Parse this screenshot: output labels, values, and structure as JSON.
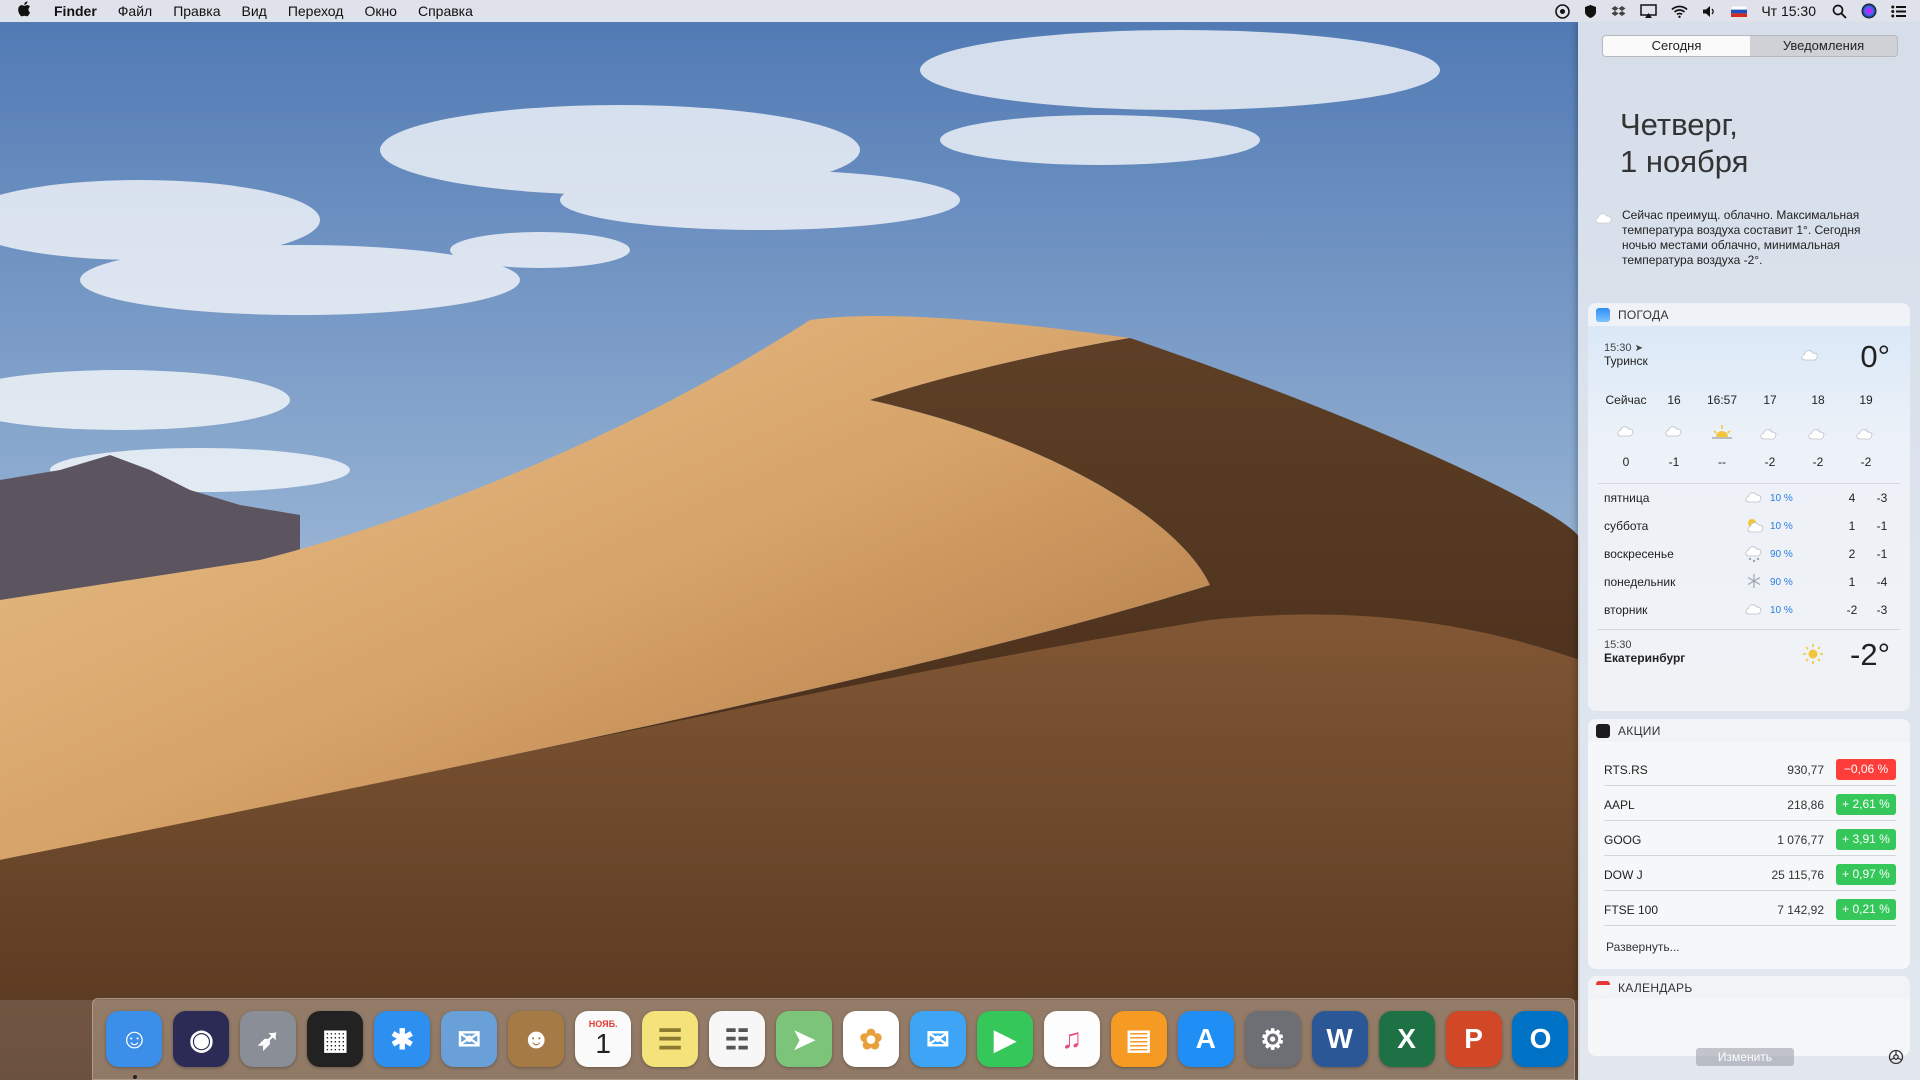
{
  "menubar": {
    "app": "Finder",
    "items": [
      "Файл",
      "Правка",
      "Вид",
      "Переход",
      "Окно",
      "Справка"
    ],
    "clock": "Чт 15:30",
    "status_icons": [
      "info-circle-icon",
      "shield-icon",
      "dropbox-icon",
      "airplay-icon",
      "wifi-icon",
      "volume-icon",
      "russian-flag-icon",
      "search-icon",
      "siri-icon",
      "notification-center-icon"
    ]
  },
  "sidebar": {
    "tabs": [
      "Сегодня",
      "Уведомления"
    ],
    "date_line1": "Четверг,",
    "date_line2": "1 ноября",
    "summary": "Сейчас преимущ. облачно. Максимальная температура воздуха составит 1°. Сегодня ночью местами облачно, минимальная температура воздуха -2°.",
    "weather": {
      "title": "ПОГОДА",
      "location1": {
        "time": "15:30",
        "name": "Туринск",
        "temp": "0°"
      },
      "hours": [
        "Сейчас",
        "16",
        "16:57",
        "17",
        "18",
        "19"
      ],
      "hour_temps": [
        "0",
        "-1",
        "--",
        "-2",
        "-2",
        "-2"
      ],
      "hour_icons": [
        "cloud-icon",
        "cloud-icon",
        "sunset-icon",
        "cloud-night-icon",
        "cloud-night-icon",
        "cloud-night-icon"
      ],
      "days": [
        {
          "name": "пятница",
          "pct": "10 %",
          "hi": "4",
          "lo": "-3",
          "icon": "cloud-icon"
        },
        {
          "name": "суббота",
          "pct": "10 %",
          "hi": "1",
          "lo": "-1",
          "icon": "sun-cloud-icon"
        },
        {
          "name": "воскресенье",
          "pct": "90 %",
          "hi": "2",
          "lo": "-1",
          "icon": "snow-cloud-icon"
        },
        {
          "name": "понедельник",
          "pct": "90 %",
          "hi": "1",
          "lo": "-4",
          "icon": "snowflake-icon"
        },
        {
          "name": "вторник",
          "pct": "10 %",
          "hi": "-2",
          "lo": "-3",
          "icon": "cloud-icon"
        }
      ],
      "location2": {
        "time": "15:30",
        "name": "Екатеринбург",
        "temp": "-2°"
      }
    },
    "stocks": {
      "title": "АКЦИИ",
      "rows": [
        {
          "name": "RTS.RS",
          "value": "930,77",
          "change": "−0,06 %",
          "up": false
        },
        {
          "name": "AAPL",
          "value": "218,86",
          "change": "+ 2,61 %",
          "up": true
        },
        {
          "name": "GOOG",
          "value": "1 076,77",
          "change": "+ 3,91 %",
          "up": true
        },
        {
          "name": "DOW J",
          "value": "25 115,76",
          "change": "+ 0,97 %",
          "up": true
        },
        {
          "name": "FTSE 100",
          "value": "7 142,92",
          "change": "+ 0,21 %",
          "up": true
        }
      ],
      "expand": "Развернуть..."
    },
    "calendar": {
      "title": "КАЛЕНДАРЬ"
    },
    "edit": "Изменить"
  },
  "colors": {
    "up": "#35c759",
    "down": "#fc3d39",
    "link": "#2a7be4"
  },
  "dock": {
    "apps": [
      {
        "name": "finder",
        "glyph": "☺",
        "bg": "#3b8fe8"
      },
      {
        "name": "siri",
        "glyph": "◉",
        "bg": "#2b2b55"
      },
      {
        "name": "launchpad",
        "glyph": "➶",
        "bg": "#8a8e96"
      },
      {
        "name": "photo-slideshow",
        "glyph": "▦",
        "bg": "#222"
      },
      {
        "name": "safari",
        "glyph": "✱",
        "bg": "#2d8ff0"
      },
      {
        "name": "mail",
        "glyph": "✉",
        "bg": "#6aa0d8"
      },
      {
        "name": "contacts",
        "glyph": "☻",
        "bg": "#a67a45"
      },
      {
        "name": "calendar",
        "glyph": "1",
        "bg": "#fafafa",
        "sub": "НОЯБ."
      },
      {
        "name": "notes",
        "glyph": "☰",
        "bg": "#f5e27a"
      },
      {
        "name": "reminders",
        "glyph": "☷",
        "bg": "#f7f7f7"
      },
      {
        "name": "maps",
        "glyph": "➤",
        "bg": "#7bc47a"
      },
      {
        "name": "photos",
        "glyph": "✿",
        "bg": "#ffffff"
      },
      {
        "name": "messages",
        "glyph": "✉",
        "bg": "#3ea4f5"
      },
      {
        "name": "facetime",
        "glyph": "▶",
        "bg": "#35c759"
      },
      {
        "name": "itunes",
        "glyph": "♫",
        "bg": "#fdfdfd"
      },
      {
        "name": "ibooks",
        "glyph": "▤",
        "bg": "#f59a23"
      },
      {
        "name": "app-store",
        "glyph": "A",
        "bg": "#1f8ef5"
      },
      {
        "name": "system-preferences",
        "glyph": "⚙",
        "bg": "#6d6f74"
      },
      {
        "name": "word",
        "glyph": "W",
        "bg": "#2b5797"
      },
      {
        "name": "excel",
        "glyph": "X",
        "bg": "#1e7145"
      },
      {
        "name": "powerpoint",
        "glyph": "P",
        "bg": "#d24726"
      },
      {
        "name": "outlook",
        "glyph": "O",
        "bg": "#0072c6"
      }
    ]
  }
}
